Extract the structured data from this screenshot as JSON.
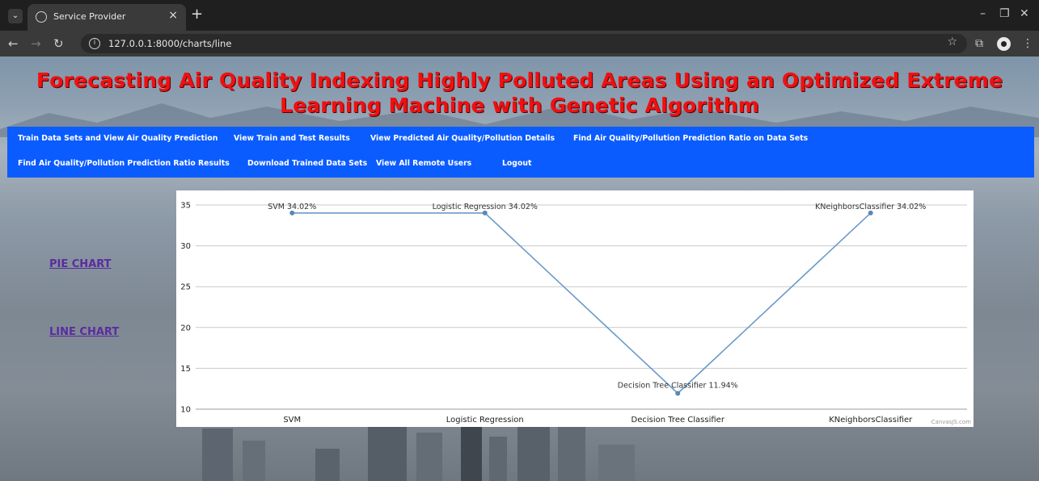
{
  "browser": {
    "tab_title": "Service Provider",
    "url": "127.0.0.1:8000/charts/line"
  },
  "page": {
    "title": "Forecasting Air Quality Indexing Highly Polluted Areas Using an Optimized Extreme Learning Machine with Genetic Algorithm",
    "nav": {
      "row1": [
        "Train Data Sets and View Air Quality Prediction",
        "View Train and Test Results",
        "View Predicted Air Quality/Pollution Details",
        "Find Air Quality/Pollution Prediction Ratio on Data Sets"
      ],
      "row2": [
        "Find Air Quality/Pollution Prediction Ratio Results",
        "Download Trained Data Sets",
        "View All Remote Users",
        "Logout"
      ]
    },
    "side_links": {
      "pie": "PIE CHART",
      "line": "LINE CHART"
    },
    "credit": "CanvasJS.com"
  },
  "colors": {
    "title": "#f01010",
    "nav_bg": "#0b5cff",
    "line": "#6a9ac8",
    "link": "#5a2ca0"
  },
  "chart_data": {
    "type": "line",
    "categories": [
      "SVM",
      "Logistic Regression",
      "Decision Tree Classifier",
      "KNeighborsClassifier"
    ],
    "values": [
      34.02,
      34.02,
      11.94,
      34.02
    ],
    "point_labels": [
      "SVM 34.02%",
      "Logistic Regression 34.02%",
      "Decision Tree Classifier 11.94%",
      "KNeighborsClassifier 34.02%"
    ],
    "ylim": [
      10,
      35
    ],
    "yticks": [
      10,
      15,
      20,
      25,
      30,
      35
    ],
    "grid": true
  }
}
